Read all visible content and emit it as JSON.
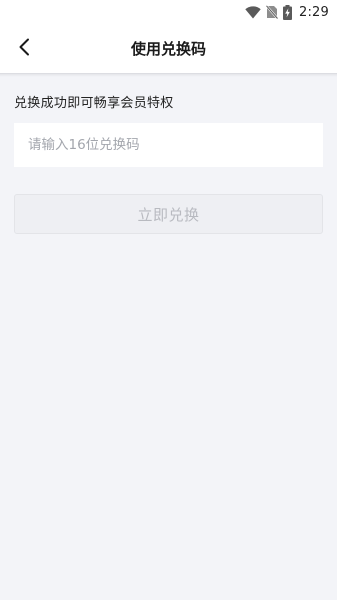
{
  "status_bar": {
    "time": "2:29",
    "icons": [
      "wifi-icon",
      "no-sim-icon",
      "battery-charging-icon"
    ]
  },
  "header": {
    "back_icon": "chevron-left-icon",
    "title": "使用兑换码"
  },
  "main": {
    "hint": "兑换成功即可畅享会员特权",
    "code_input": {
      "value": "",
      "placeholder": "请输入16位兑换码"
    },
    "redeem_button": {
      "label": "立即兑换",
      "enabled": false
    }
  },
  "colors": {
    "background": "#f3f4f8",
    "surface": "#ffffff",
    "disabled_button_bg": "#eeeff3",
    "disabled_button_text": "#b8bac0",
    "placeholder_text": "#a3a6ad"
  }
}
